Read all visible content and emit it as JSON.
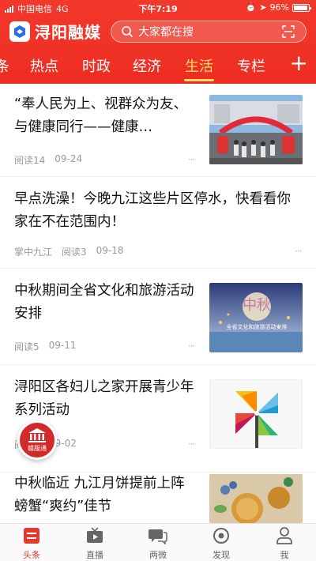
{
  "status": {
    "carrier": "中国电信",
    "network": "4G",
    "time": "下午7:19",
    "battery": "96%"
  },
  "header": {
    "app_name": "浔阳融媒",
    "search_placeholder": "大家都在搜"
  },
  "tabs": [
    {
      "label": "条"
    },
    {
      "label": "热点"
    },
    {
      "label": "时政"
    },
    {
      "label": "经济"
    },
    {
      "label": "生活",
      "active": true
    },
    {
      "label": "专栏"
    }
  ],
  "tab_more": "+",
  "feed": [
    {
      "title": "“奉人民为上、视群众为友、与健康同行——健康…",
      "meta": [
        "阅读14",
        "09-24"
      ]
    },
    {
      "title": "早点洗澡！今晚九江这些片区停水，快看看你家在不在范围内！",
      "meta": [
        "掌中九江",
        "阅读3",
        "09-18"
      ]
    },
    {
      "title": "中秋期间全省文化和旅游活动安排",
      "meta": [
        "阅读5",
        "09-11"
      ]
    },
    {
      "title": "浔阳区各妇儿之家开展青少年系列活动",
      "meta": [
        "阅",
        "09-02"
      ]
    },
    {
      "title": "中秋临近 九江月饼提前上阵 螃蟹“爽约”佳节",
      "meta": []
    }
  ],
  "thumb_text": {
    "mid_autumn_big": "中秋",
    "mid_autumn_small": "全省文化和旅游活动安排"
  },
  "float_badge": "赣服通",
  "dots": "···",
  "bottom_nav": [
    {
      "label": "头条",
      "icon": "headline-icon",
      "active": true
    },
    {
      "label": "直播",
      "icon": "tv-icon"
    },
    {
      "label": "两微",
      "icon": "chat-icon"
    },
    {
      "label": "发现",
      "icon": "discover-icon"
    },
    {
      "label": "我",
      "icon": "user-icon"
    }
  ],
  "colors": {
    "brand_red": "#ee2d22",
    "active_tab": "#ffdf6b",
    "nav_active": "#e23b2d"
  }
}
